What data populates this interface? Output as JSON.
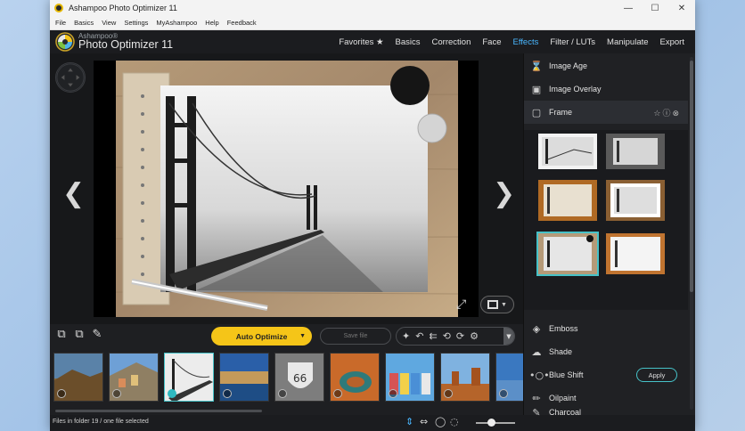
{
  "window": {
    "title": "Ashampoo Photo Optimizer 11"
  },
  "menubar": [
    "File",
    "Basics",
    "View",
    "Settings",
    "MyAshampoo",
    "Help",
    "Feedback"
  ],
  "brand": {
    "small": "Ashampoo®",
    "big": "Photo Optimizer 11"
  },
  "nav": [
    {
      "label": "Favorites ★",
      "active": false
    },
    {
      "label": "Basics",
      "active": false
    },
    {
      "label": "Correction",
      "active": false
    },
    {
      "label": "Face",
      "active": false
    },
    {
      "label": "Effects",
      "active": true
    },
    {
      "label": "Filter / LUTs",
      "active": false
    },
    {
      "label": "Manipulate",
      "active": false
    },
    {
      "label": "Export",
      "active": false
    }
  ],
  "toolbar": {
    "auto_optimize": "Auto Optimize",
    "save_file": "Save file"
  },
  "panel": {
    "items_top": [
      {
        "label": "Image Age",
        "icon": "hourglass-icon"
      },
      {
        "label": "Image Overlay",
        "icon": "image-overlay-icon"
      },
      {
        "label": "Frame",
        "icon": "frame-icon",
        "active": true
      }
    ],
    "apply": "Apply",
    "items_bottom": [
      {
        "label": "Emboss",
        "icon": "emboss-icon"
      },
      {
        "label": "Shade",
        "icon": "shade-icon"
      },
      {
        "label": "Blue Shift",
        "icon": "blue-shift-icon"
      },
      {
        "label": "Oilpaint",
        "icon": "brush-icon"
      },
      {
        "label": "Charcoal",
        "icon": "pencil-icon"
      }
    ]
  },
  "status": {
    "text": "Files in folder 19 / one file selected"
  },
  "colors": {
    "accent_blue": "#49b7ff",
    "auto_optimize_yellow": "#f5c518",
    "selection_teal": "#46c2c8"
  }
}
